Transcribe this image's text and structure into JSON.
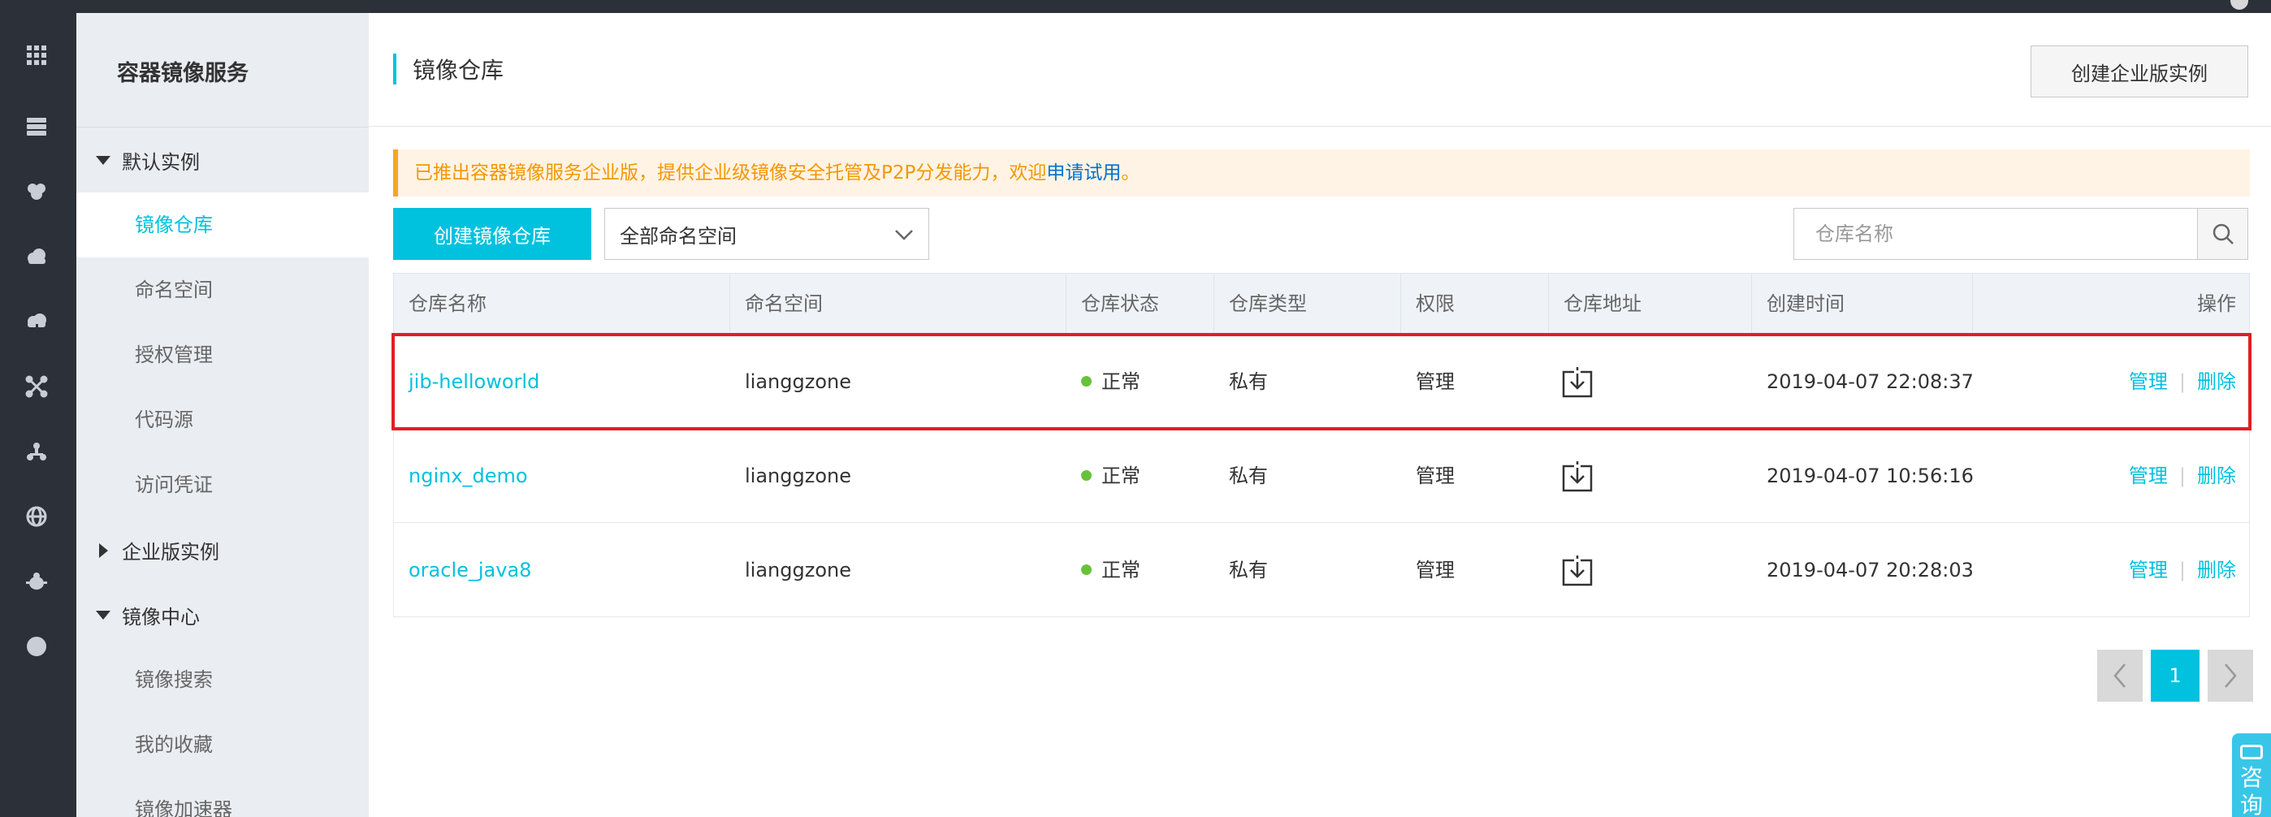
{
  "sidebar": {
    "title": "容器镜像服务",
    "groups": [
      {
        "label": "默认实例",
        "expanded": true
      },
      {
        "label": "企业版实例",
        "expanded": false
      },
      {
        "label": "镜像中心",
        "expanded": true
      }
    ],
    "items": [
      {
        "label": "镜像仓库",
        "active": true
      },
      {
        "label": "命名空间"
      },
      {
        "label": "授权管理"
      },
      {
        "label": "代码源"
      },
      {
        "label": "访问凭证"
      },
      {
        "label": "镜像搜索"
      },
      {
        "label": "我的收藏"
      },
      {
        "label": "镜像加速器"
      }
    ]
  },
  "rail_icons": [
    "apps-grid-icon",
    "server-icon",
    "brain-icon",
    "cloud-icon",
    "cloud-sync-icon",
    "network-icon",
    "cluster-icon",
    "globe-icon",
    "bug-icon",
    "circle-icon"
  ],
  "header": {
    "title": "镜像仓库",
    "enterprise_button": "创建企业版实例"
  },
  "notice": {
    "text": "已推出容器镜像服务企业版，提供企业级镜像安全托管及P2P分发能力，欢迎",
    "link": "申请试用",
    "suffix": "。"
  },
  "toolbar": {
    "create_button": "创建镜像仓库",
    "namespace_select": "全部命名空间",
    "search_placeholder": "仓库名称"
  },
  "table": {
    "columns": [
      "仓库名称",
      "命名空间",
      "仓库状态",
      "仓库类型",
      "权限",
      "仓库地址",
      "创建时间",
      "操作"
    ],
    "rows": [
      {
        "name": "jib-helloworld",
        "namespace": "lianggzone",
        "status": "正常",
        "type": "私有",
        "permission": "管理",
        "created": "2019-04-07 22:08:37",
        "op_manage": "管理",
        "op_delete": "删除",
        "highlighted": true
      },
      {
        "name": "nginx_demo",
        "namespace": "lianggzone",
        "status": "正常",
        "type": "私有",
        "permission": "管理",
        "created": "2019-04-07 10:56:16",
        "op_manage": "管理",
        "op_delete": "删除",
        "highlighted": false
      },
      {
        "name": "oracle_java8",
        "namespace": "lianggzone",
        "status": "正常",
        "type": "私有",
        "permission": "管理",
        "created": "2019-04-07 20:28:03",
        "op_manage": "管理",
        "op_delete": "删除",
        "highlighted": false
      }
    ]
  },
  "pagination": {
    "current": "1"
  },
  "consult": {
    "label": "咨询"
  },
  "colors": {
    "accent": "#00c1de",
    "status_ok": "#67c23a",
    "highlight": "#e02020",
    "notice": "#f39800"
  }
}
